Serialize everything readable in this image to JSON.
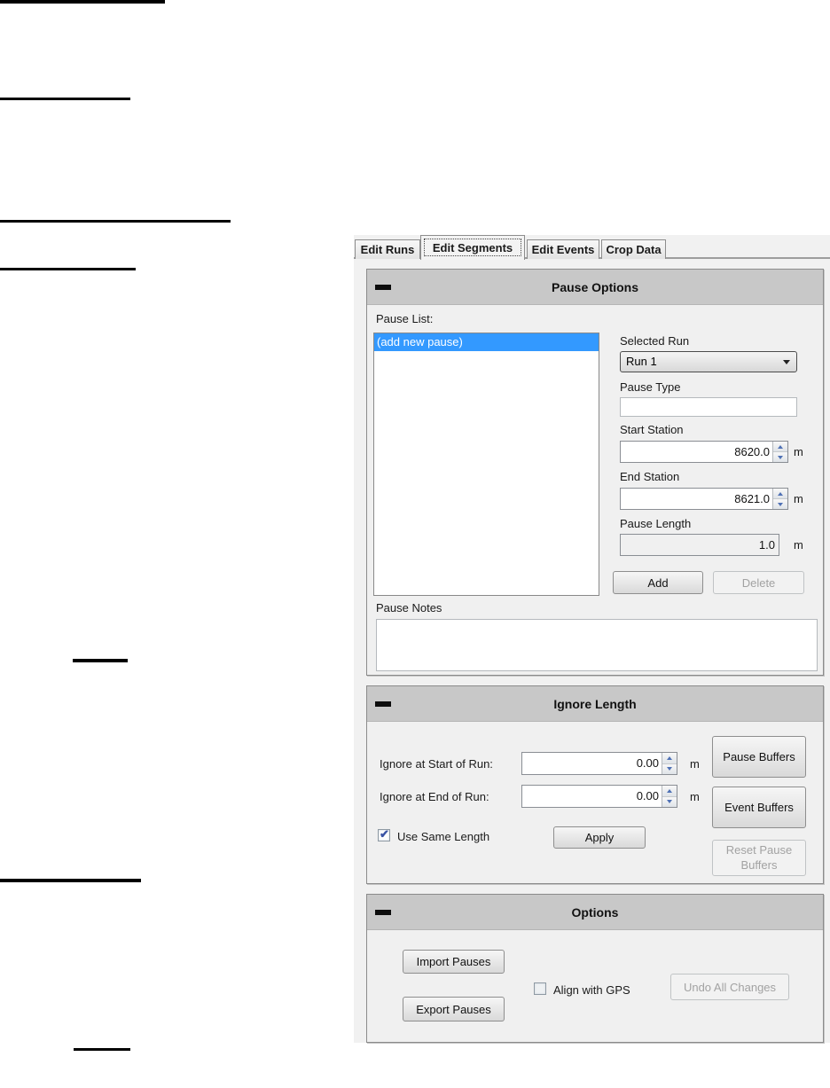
{
  "tabs": {
    "items": [
      {
        "label": "Edit Runs",
        "active": false
      },
      {
        "label": "Edit Segments",
        "active": true
      },
      {
        "label": "Edit Events",
        "active": false
      },
      {
        "label": "Crop Data",
        "active": false
      }
    ]
  },
  "pause_options": {
    "title": "Pause Options",
    "pause_list_label": "Pause List:",
    "pause_list_items": [
      "(add new pause)"
    ],
    "selected_run_label": "Selected Run",
    "selected_run_value": "Run 1",
    "pause_type_label": "Pause Type",
    "pause_type_value": "",
    "start_station_label": "Start Station",
    "start_station_value": "8620.0",
    "start_station_unit": "m",
    "end_station_label": "End Station",
    "end_station_value": "8621.0",
    "end_station_unit": "m",
    "pause_length_label": "Pause Length",
    "pause_length_value": "1.0",
    "pause_length_unit": "m",
    "add_button": "Add",
    "delete_button": "Delete",
    "pause_notes_label": "Pause Notes",
    "pause_notes_value": ""
  },
  "ignore_length": {
    "title": "Ignore Length",
    "ignore_start_label": "Ignore at Start of Run:",
    "ignore_start_value": "0.00",
    "ignore_start_unit": "m",
    "ignore_end_label": "Ignore at End of Run:",
    "ignore_end_value": "0.00",
    "ignore_end_unit": "m",
    "use_same_length_label": "Use Same Length",
    "use_same_length_checked": true,
    "use_same_length_glyph": "✔",
    "apply_button": "Apply",
    "pause_buffers_button": "Pause Buffers",
    "event_buffers_button": "Event Buffers",
    "reset_pause_buffers_button": "Reset Pause Buffers"
  },
  "options": {
    "title": "Options",
    "import_button": "Import Pauses",
    "export_button": "Export Pauses",
    "align_gps_label": "Align with GPS",
    "align_gps_checked": false,
    "align_gps_glyph": "",
    "undo_button": "Undo All Changes"
  },
  "colors": {
    "selection_blue": "#3399ff",
    "header_gray": "#c8c8c8",
    "panel_gray": "#f0f0f0",
    "spin_arrow_blue": "#4f71b5",
    "disabled_text": "#a2a2a2"
  }
}
